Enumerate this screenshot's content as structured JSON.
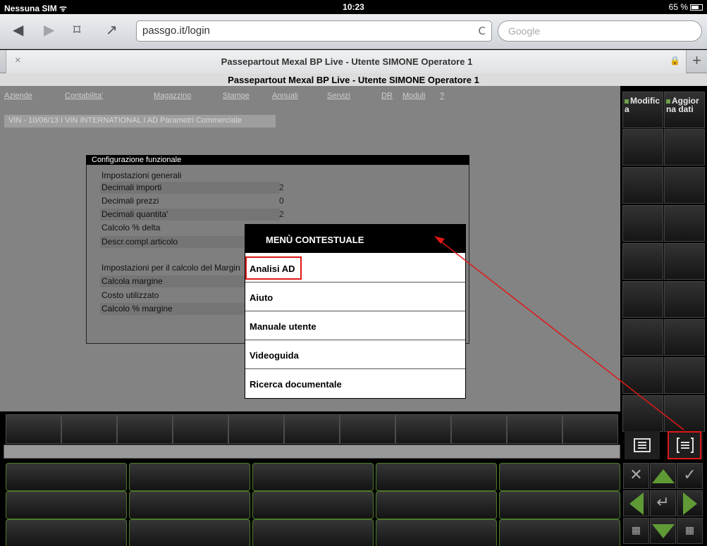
{
  "status_bar": {
    "carrier": "Nessuna SIM ᯤ",
    "time": "10:23",
    "battery": "65 %"
  },
  "safari": {
    "back_icon": "◀",
    "forward_icon": "▶",
    "bookmarks_icon": "⌑",
    "share_icon": "↗",
    "url": "passgo.it/login",
    "reload_icon": "C",
    "search_placeholder": "Google"
  },
  "tab": {
    "close": "×",
    "title": "Passepartout Mexal BP Live - Utente SIMONE Operatore 1",
    "lock": "🔒",
    "plus": "+"
  },
  "app_title": "Passepartout Mexal BP Live - Utente SIMONE Operatore 1",
  "menu": [
    "Aziende",
    "Contabilita'",
    "Magazzino",
    "Stampe",
    "Annuali",
    "Servizi",
    "DR",
    "Moduli",
    "?"
  ],
  "breadcrumb": "VIN - 10/06/13 I VIN INTERNATIONAL  I AD Parametri Commerciale",
  "config": {
    "title": "Configurazione funzionale",
    "section1": "Impostazioni generali",
    "rows1": [
      {
        "label": "Decimali importi",
        "value": "2"
      },
      {
        "label": "Decimali prezzi",
        "value": "0"
      },
      {
        "label": "Decimali quantita'",
        "value": "2"
      },
      {
        "label": "Calcolo % delta",
        "value": ""
      },
      {
        "label": "Descr.compl.articolo",
        "value": ""
      }
    ],
    "section2": "Impostazioni per il calcolo del Margin",
    "rows2": [
      {
        "label": "Calcola margine",
        "value": ""
      },
      {
        "label": "Costo utilizzato",
        "value": ""
      },
      {
        "label": "Calcolo % margine",
        "value": ""
      }
    ]
  },
  "context_menu": {
    "title": "MENÙ CONTESTUALE",
    "items": [
      "Analisi AD",
      "Aiuto",
      "Manuale utente",
      "Videoguida",
      "Ricerca documentale"
    ]
  },
  "function_keys": {
    "modifica": "Modific a",
    "aggiorna": "Aggior na dati"
  },
  "icons": {
    "list": "list-icon",
    "context": "context-menu-icon",
    "cancel": "✕",
    "confirm": "✓",
    "enter": "↵",
    "keypad": "▦"
  },
  "colors": {
    "highlight": "#e01818",
    "green_key_border": "#4d7a2a",
    "green_arrow": "#5f9a35"
  }
}
